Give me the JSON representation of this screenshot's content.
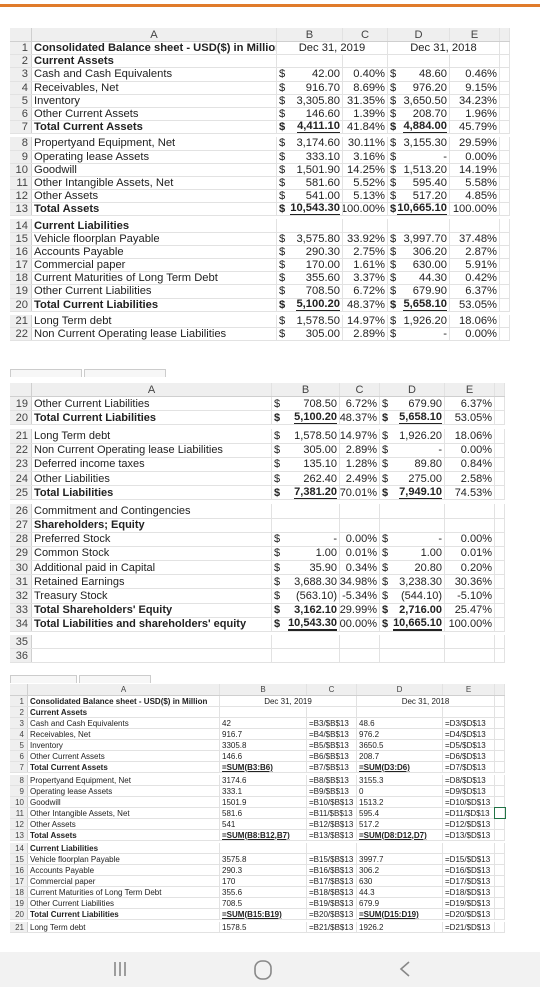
{
  "colors": {
    "accent": "#e07b2a",
    "gridline": "#e2e2e2",
    "header_bg": "#efefef"
  },
  "sheets": [
    {
      "columns": [
        "",
        "A",
        "B",
        "C",
        "D",
        "E"
      ],
      "rows": [
        {
          "n": "1",
          "a": "Consolidated Balance sheet - USD($) in Million",
          "b2": "Dec 31, 2019",
          "d2": "Dec 31, 2018",
          "bold": true
        },
        {
          "n": "2",
          "a": "Current Assets",
          "bold": true
        },
        {
          "n": "3",
          "a": "Cash and Cash Equivalents",
          "b": [
            "$",
            "42.00"
          ],
          "c": "0.40%",
          "d": [
            "$",
            "48.60"
          ],
          "e": "0.46%"
        },
        {
          "n": "4",
          "a": "Receivables, Net",
          "b": [
            "$",
            "916.70"
          ],
          "c": "8.69%",
          "d": [
            "$",
            "976.20"
          ],
          "e": "9.15%"
        },
        {
          "n": "5",
          "a": "Inventory",
          "b": [
            "$",
            "3,305.80"
          ],
          "c": "31.35%",
          "d": [
            "$",
            "3,650.50"
          ],
          "e": "34.23%"
        },
        {
          "n": "6",
          "a": "Other Current Assets",
          "b": [
            "$",
            "146.60"
          ],
          "c": "1.39%",
          "d": [
            "$",
            "208.70"
          ],
          "e": "1.96%"
        },
        {
          "n": "7",
          "a": "Total Current Assets",
          "b": [
            "$",
            "4,411.10"
          ],
          "c": "41.84%",
          "d": [
            "$",
            "4,884.00"
          ],
          "e": "45.79%",
          "bold": true,
          "total": true
        },
        {
          "n": "8",
          "a": "Propertyand Equipment, Net",
          "b": [
            "$",
            "3,174.60"
          ],
          "c": "30.11%",
          "d": [
            "$",
            "3,155.30"
          ],
          "e": "29.59%"
        },
        {
          "n": "9",
          "a": "Operating lease Assets",
          "b": [
            "$",
            "333.10"
          ],
          "c": "3.16%",
          "d": [
            "$",
            "-"
          ],
          "e": "0.00%"
        },
        {
          "n": "10",
          "a": "Goodwill",
          "b": [
            "$",
            "1,501.90"
          ],
          "c": "14.25%",
          "d": [
            "$",
            "1,513.20"
          ],
          "e": "14.19%"
        },
        {
          "n": "11",
          "a": "Other Intangible Assets, Net",
          "b": [
            "$",
            "581.60"
          ],
          "c": "5.52%",
          "d": [
            "$",
            "595.40"
          ],
          "e": "5.58%"
        },
        {
          "n": "12",
          "a": "Other Assets",
          "b": [
            "$",
            "541.00"
          ],
          "c": "5.13%",
          "d": [
            "$",
            "517.20"
          ],
          "e": "4.85%"
        },
        {
          "n": "13",
          "a": "Total Assets",
          "b": [
            "$",
            "10,543.30"
          ],
          "c": "100.00%",
          "d": [
            "$",
            "10,665.10"
          ],
          "e": "100.00%",
          "bold": true,
          "total": true
        },
        {
          "n": "14",
          "a": "Current Liabilities",
          "bold": true
        },
        {
          "n": "15",
          "a": "Vehicle floorplan Payable",
          "b": [
            "$",
            "3,575.80"
          ],
          "c": "33.92%",
          "d": [
            "$",
            "3,997.70"
          ],
          "e": "37.48%"
        },
        {
          "n": "16",
          "a": "Accounts Payable",
          "b": [
            "$",
            "290.30"
          ],
          "c": "2.75%",
          "d": [
            "$",
            "306.20"
          ],
          "e": "2.87%"
        },
        {
          "n": "17",
          "a": "Commercial paper",
          "b": [
            "$",
            "170.00"
          ],
          "c": "1.61%",
          "d": [
            "$",
            "630.00"
          ],
          "e": "5.91%"
        },
        {
          "n": "18",
          "a": "Current Maturities of Long Term Debt",
          "b": [
            "$",
            "355.60"
          ],
          "c": "3.37%",
          "d": [
            "$",
            "44.30"
          ],
          "e": "0.42%"
        },
        {
          "n": "19",
          "a": "Other Current Liabilities",
          "b": [
            "$",
            "708.50"
          ],
          "c": "6.72%",
          "d": [
            "$",
            "679.90"
          ],
          "e": "6.37%"
        },
        {
          "n": "20",
          "a": "Total Current Liabilities",
          "b": [
            "$",
            "5,100.20"
          ],
          "c": "48.37%",
          "d": [
            "$",
            "5,658.10"
          ],
          "e": "53.05%",
          "bold": true,
          "total": true
        },
        {
          "n": "21",
          "a": "Long Term debt",
          "b": [
            "$",
            "1,578.50"
          ],
          "c": "14.97%",
          "d": [
            "$",
            "1,926.20"
          ],
          "e": "18.06%"
        },
        {
          "n": "22",
          "a": "Non Current Operating lease Liabilities",
          "b": [
            "$",
            "305.00"
          ],
          "c": "2.89%",
          "d": [
            "$",
            "-"
          ],
          "e": "0.00%"
        }
      ]
    },
    {
      "columns": [
        "",
        "A",
        "B",
        "C",
        "D",
        "E"
      ],
      "rows": [
        {
          "n": "19",
          "a": "Other Current Liabilities",
          "b": [
            "$",
            "708.50"
          ],
          "c": "6.72%",
          "d": [
            "$",
            "679.90"
          ],
          "e": "6.37%"
        },
        {
          "n": "20",
          "a": "Total Current Liabilities",
          "b": [
            "$",
            "5,100.20"
          ],
          "c": "48.37%",
          "d": [
            "$",
            "5,658.10"
          ],
          "e": "53.05%",
          "bold": true,
          "total": true
        },
        {
          "n": "21",
          "a": "Long Term debt",
          "b": [
            "$",
            "1,578.50"
          ],
          "c": "14.97%",
          "d": [
            "$",
            "1,926.20"
          ],
          "e": "18.06%"
        },
        {
          "n": "22",
          "a": "Non Current Operating lease Liabilities",
          "b": [
            "$",
            "305.00"
          ],
          "c": "2.89%",
          "d": [
            "$",
            "-"
          ],
          "e": "0.00%"
        },
        {
          "n": "23",
          "a": "Deferred income taxes",
          "b": [
            "$",
            "135.10"
          ],
          "c": "1.28%",
          "d": [
            "$",
            "89.80"
          ],
          "e": "0.84%"
        },
        {
          "n": "24",
          "a": "Other Liabilities",
          "b": [
            "$",
            "262.40"
          ],
          "c": "2.49%",
          "d": [
            "$",
            "275.00"
          ],
          "e": "2.58%"
        },
        {
          "n": "25",
          "a": "Total Liabilities",
          "b": [
            "$",
            "7,381.20"
          ],
          "c": "70.01%",
          "d": [
            "$",
            "7,949.10"
          ],
          "e": "74.53%",
          "bold": true,
          "total": true
        },
        {
          "n": "26",
          "a": "Commitment and Contingencies"
        },
        {
          "n": "27",
          "a": "Shareholders; Equity",
          "bold": true
        },
        {
          "n": "28",
          "a": "Preferred Stock",
          "b": [
            "$",
            "-"
          ],
          "c": "0.00%",
          "d": [
            "$",
            "-"
          ],
          "e": "0.00%"
        },
        {
          "n": "29",
          "a": "Common Stock",
          "b": [
            "$",
            "1.00"
          ],
          "c": "0.01%",
          "d": [
            "$",
            "1.00"
          ],
          "e": "0.01%"
        },
        {
          "n": "30",
          "a": "Additional paid in Capital",
          "b": [
            "$",
            "35.90"
          ],
          "c": "0.34%",
          "d": [
            "$",
            "20.80"
          ],
          "e": "0.20%"
        },
        {
          "n": "31",
          "a": "Retained Earnings",
          "b": [
            "$",
            "3,688.30"
          ],
          "c": "34.98%",
          "d": [
            "$",
            "3,238.30"
          ],
          "e": "30.36%"
        },
        {
          "n": "32",
          "a": "Treasury Stock",
          "b": [
            "$",
            "(563.10)"
          ],
          "c": "-5.34%",
          "d": [
            "$",
            "(544.10)"
          ],
          "e": "-5.10%"
        },
        {
          "n": "33",
          "a": "Total Shareholders' Equity",
          "b": [
            "$",
            "3,162.10"
          ],
          "c": "29.99%",
          "d": [
            "$",
            "2,716.00"
          ],
          "e": "25.47%",
          "bold": true
        },
        {
          "n": "34",
          "a": "Total Liabilities and shareholders' equity",
          "b": [
            "$",
            "10,543.30"
          ],
          "c": "100.00%",
          "d": [
            "$",
            "10,665.10"
          ],
          "e": "100.00%",
          "bold": true,
          "total": true
        },
        {
          "n": "35",
          "a": ""
        },
        {
          "n": "36",
          "a": ""
        }
      ]
    },
    {
      "columns": [
        "",
        "A",
        "B",
        "C",
        "D",
        "E"
      ],
      "rows": [
        {
          "n": "1",
          "a": "Consolidated Balance sheet - USD($) in Million",
          "b2": "Dec 31, 2019",
          "d2": "Dec 31, 2018",
          "bold": true
        },
        {
          "n": "2",
          "a": "Current Assets",
          "bold": true
        },
        {
          "n": "3",
          "a": "Cash and Cash Equivalents",
          "b": "42",
          "c": "=B3/$B$13",
          "d": "48.6",
          "e": "=D3/$D$13"
        },
        {
          "n": "4",
          "a": "Receivables, Net",
          "b": "916.7",
          "c": "=B4/$B$13",
          "d": "976.2",
          "e": "=D4/$D$13"
        },
        {
          "n": "5",
          "a": "Inventory",
          "b": "3305.8",
          "c": "=B5/$B$13",
          "d": "3650.5",
          "e": "=D5/$D$13"
        },
        {
          "n": "6",
          "a": "Other Current Assets",
          "b": "146.6",
          "c": "=B6/$B$13",
          "d": "208.7",
          "e": "=D6/$D$13"
        },
        {
          "n": "7",
          "a": "Total Current Assets",
          "b": "=SUM(B3:B6)",
          "c": "=B7/$B$13",
          "d": "=SUM(D3:D6)",
          "e": "=D7/$D$13",
          "bold": true,
          "total": true
        },
        {
          "n": "8",
          "a": "Propertyand Equipment, Net",
          "b": "3174.6",
          "c": "=B8/$B$13",
          "d": "3155.3",
          "e": "=D8/$D$13"
        },
        {
          "n": "9",
          "a": "Operating lease Assets",
          "b": "333.1",
          "c": "=B9/$B$13",
          "d": "0",
          "e": "=D9/$D$13"
        },
        {
          "n": "10",
          "a": "Goodwill",
          "b": "1501.9",
          "c": "=B10/$B$13",
          "d": "1513.2",
          "e": "=D10/$D$13"
        },
        {
          "n": "11",
          "a": "Other Intangible Assets, Net",
          "b": "581.6",
          "c": "=B11/$B$13",
          "d": "595.4",
          "e": "=D11/$D$13"
        },
        {
          "n": "12",
          "a": "Other Assets",
          "b": "541",
          "c": "=B12/$B$13",
          "d": "517.2",
          "e": "=D12/$D$13"
        },
        {
          "n": "13",
          "a": "Total Assets",
          "b": "=SUM(B8:B12,B7)",
          "c": "=B13/$B$13",
          "d": "=SUM(D8:D12,D7)",
          "e": "=D13/$D$13",
          "bold": true,
          "total": true
        },
        {
          "n": "14",
          "a": "Current Liabilities",
          "bold": true
        },
        {
          "n": "15",
          "a": "Vehicle floorplan Payable",
          "b": "3575.8",
          "c": "=B15/$B$13",
          "d": "3997.7",
          "e": "=D15/$D$13"
        },
        {
          "n": "16",
          "a": "Accounts Payable",
          "b": "290.3",
          "c": "=B16/$B$13",
          "d": "306.2",
          "e": "=D16/$D$13"
        },
        {
          "n": "17",
          "a": "Commercial paper",
          "b": "170",
          "c": "=B17/$B$13",
          "d": "630",
          "e": "=D17/$D$13"
        },
        {
          "n": "18",
          "a": "Current Maturities of Long Term Debt",
          "b": "355.6",
          "c": "=B18/$B$13",
          "d": "44.3",
          "e": "=D18/$D$13"
        },
        {
          "n": "19",
          "a": "Other Current Liabilities",
          "b": "708.5",
          "c": "=B19/$B$13",
          "d": "679.9",
          "e": "=D19/$D$13"
        },
        {
          "n": "20",
          "a": "Total Current Liabilities",
          "b": "=SUM(B15:B19)",
          "c": "=B20/$B$13",
          "d": "=SUM(D15:D19)",
          "e": "=D20/$D$13",
          "bold": true,
          "total": true
        },
        {
          "n": "21",
          "a": "Long Term debt",
          "b": "1578.5",
          "c": "=B21/$B$13",
          "d": "1926.2",
          "e": "=D21/$D$13"
        }
      ]
    }
  ],
  "navbar": {
    "icons": [
      "recent-apps-icon",
      "home-icon",
      "back-icon"
    ]
  }
}
